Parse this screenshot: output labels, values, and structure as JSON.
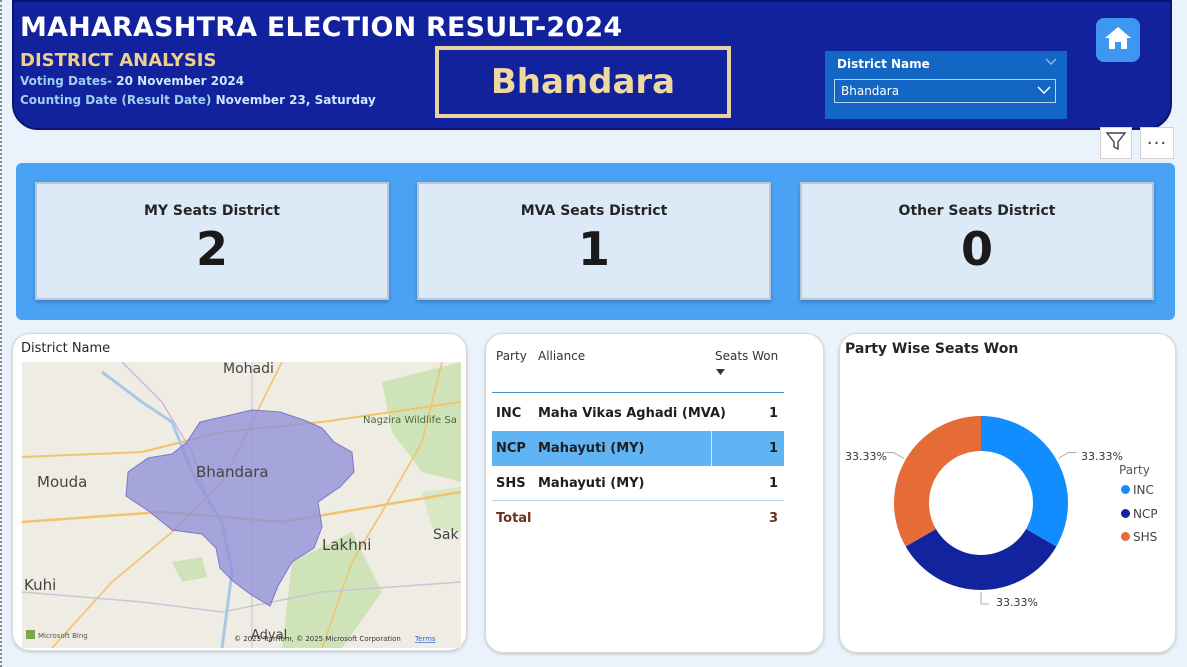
{
  "header": {
    "title": "MAHARASHTRA ELECTION RESULT-2024",
    "subtitle": "DISTRICT ANALYSIS",
    "voting_label": "Voting Dates-",
    "voting_value": "20 November 2024",
    "counting_label": "Counting Date (Result Date)",
    "counting_value": "November 23, Saturday",
    "district_display": "Bhandara"
  },
  "slicer": {
    "title": "District Name",
    "selected": "Bhandara"
  },
  "toolbar": {
    "more_label": "···"
  },
  "kpis": [
    {
      "label": "MY Seats District",
      "value": "2"
    },
    {
      "label": "MVA Seats District",
      "value": "1"
    },
    {
      "label": "Other Seats District",
      "value": "0"
    }
  ],
  "map": {
    "title": "District Name",
    "places": [
      "Mohadi",
      "Nagzira Wildlife Sa",
      "Bhandara",
      "Mouda",
      "Lakhni",
      "Sak",
      "Kuhi",
      "Adyal"
    ],
    "attribution": "© 2025 TomTom, © 2025 Microsoft Corporation",
    "terms": "Terms",
    "provider": "Microsoft Bing"
  },
  "table": {
    "headers": {
      "party": "Party",
      "alliance": "Alliance",
      "seats": "Seats Won"
    },
    "rows": [
      {
        "party": "INC",
        "alliance": "Maha Vikas Aghadi (MVA)",
        "seats": "1",
        "selected": false
      },
      {
        "party": "NCP",
        "alliance": "Mahayuti (MY)",
        "seats": "1",
        "selected": true
      },
      {
        "party": "SHS",
        "alliance": "Mahayuti (MY)",
        "seats": "1",
        "selected": false
      }
    ],
    "total_label": "Total",
    "total_value": "3"
  },
  "donut": {
    "title": "Party Wise Seats Won",
    "legend_title": "Party",
    "labels": [
      "33.33%",
      "33.33%",
      "33.33%"
    ]
  },
  "chart_data": {
    "type": "pie",
    "title": "Party Wise Seats Won",
    "categories": [
      "INC",
      "NCP",
      "SHS"
    ],
    "values": [
      1,
      1,
      1
    ],
    "percentages": [
      33.33,
      33.33,
      33.33
    ],
    "colors": [
      "#118dff",
      "#12239e",
      "#e66c37"
    ],
    "legend_title": "Party",
    "legend_position": "right"
  },
  "colors": {
    "header_bg": "#12219c",
    "accent_gold": "#efd9a3",
    "kpi_band": "#4aa2f4",
    "selected_row": "#61b4f4"
  }
}
